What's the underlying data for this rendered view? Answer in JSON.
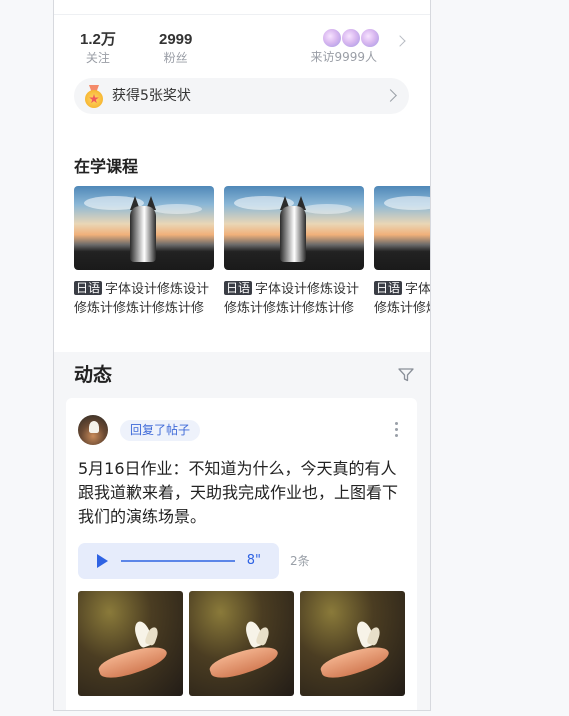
{
  "stats": {
    "following_value": "1.2万",
    "following_label": "关注",
    "fans_value": "2999",
    "fans_label": "粉丝",
    "visitors_label": "来访9999人"
  },
  "award": {
    "text": "获得5张奖状"
  },
  "courses_section": {
    "title": "在学课程",
    "items": [
      {
        "tag": "日语",
        "title": "字体设计修炼设计修炼计修炼计修炼计修炼…"
      },
      {
        "tag": "日语",
        "title": "字体设计修炼设计修炼计修炼计修炼计修炼…"
      },
      {
        "tag": "日语",
        "title": "字体设计修炼设计修炼计修炼计修炼计修炼…"
      }
    ]
  },
  "feed": {
    "title": "动态",
    "post": {
      "action_label": "回复了帖子",
      "text": "5月16日作业：不知道为什么，今天真的有人跟我道歉来着，天助我完成作业也，上图看下我们的演练场景。",
      "audio_duration": "8\"",
      "comment_count": "2条"
    }
  },
  "colors": {
    "accent": "#2f63e3",
    "pill_bg": "#eef2fb",
    "audio_bg": "#e6ecfb",
    "tag_bg": "#3a3d45"
  }
}
